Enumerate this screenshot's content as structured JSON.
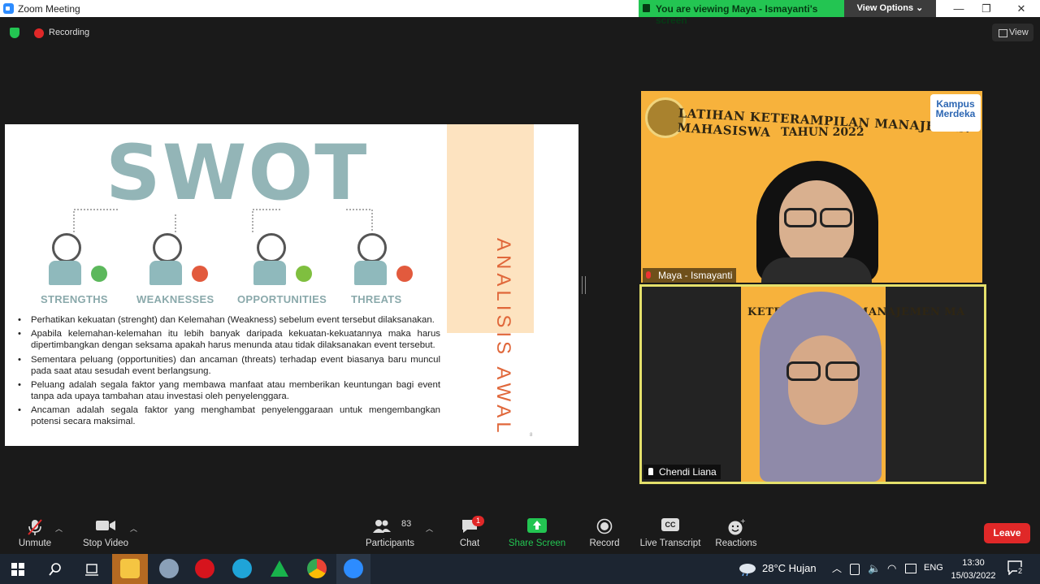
{
  "window": {
    "title": "Zoom Meeting",
    "viewing_banner": "You are viewing Maya - Ismayanti's screen",
    "view_options": "View Options ⌄",
    "minimize": "—",
    "maximize": "❐",
    "close": "✕"
  },
  "topbar": {
    "recording_label": "Recording",
    "view_label": "View"
  },
  "slide": {
    "title": "SWOT",
    "quadrants": [
      "STRENGTHS",
      "WEAKNESSES",
      "OPPORTUNITIES",
      "THREATS"
    ],
    "side_text": "ANALISIS AWAL",
    "page_number": "8",
    "bullets": [
      "Perhatikan kekuatan (strenght) dan Kelemahan (Weakness)  sebelum event tersebut dilaksanakan.",
      "Apabila kelemahan-kelemahan itu lebih banyak daripada kekuatan-kekuatannya  maka harus dipertimbangkan dengan seksama apakah harus menunda atau tidak dilaksanakan event tersebut.",
      "Sementara peluang (opportunities) dan ancaman (threats) terhadap event biasanya baru muncul pada saat atau sesudah event berlangsung.",
      "Peluang adalah segala faktor yang membawa manfaat atau memberikan keuntungan bagi event tanpa ada upaya  tambahan atau investasi oleh penyelenggara.",
      "Ancaman adalah segala faktor yang menghambat penyelenggaraan untuk mengembangkan potensi secara maksimal."
    ]
  },
  "videos": [
    {
      "name": "Maya - Ismayanti",
      "banner_line1": "LATIHAN KETERAMPILAN MANAJEMEN MAHASISWA",
      "banner_line2": "TAHUN 2022",
      "logo_text": "Kampus Merdeka"
    },
    {
      "name": "Chendi Liana",
      "banner_text": "KETERAMPILAN MANAJEMEN MA"
    }
  ],
  "toolbar": {
    "unmute": "Unmute",
    "stop_video": "Stop Video",
    "participants": "Participants",
    "participants_count": "83",
    "chat": "Chat",
    "chat_badge": "1",
    "share_screen": "Share Screen",
    "record": "Record",
    "live_transcript": "Live Transcript",
    "reactions": "Reactions",
    "leave": "Leave",
    "cc": "CC"
  },
  "taskbar": {
    "weather": "28°C  Hujan",
    "language": "ENG",
    "time": "13:30",
    "date": "15/03/2022",
    "notifications": "2"
  },
  "colors": {
    "zoom_blue": "#2d8cff",
    "viewing_green": "#23c552",
    "leave_red": "#e02828",
    "swot_teal": "#93b5b7",
    "slide_orange": "#e0673a",
    "active_speaker": "#e4e06b"
  }
}
